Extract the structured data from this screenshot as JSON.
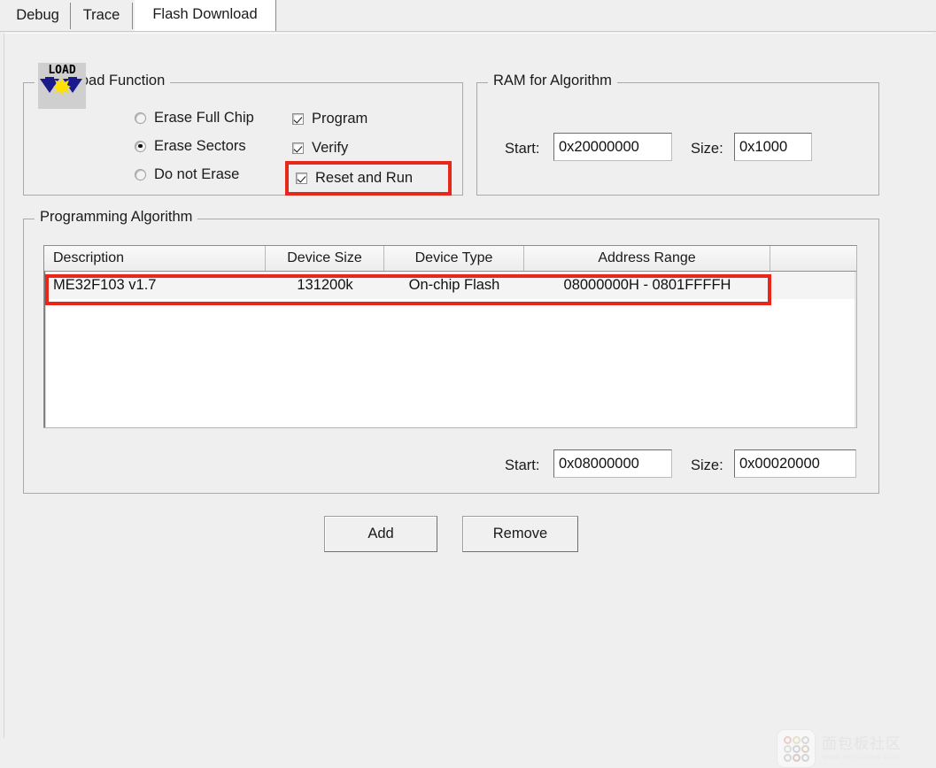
{
  "tabs": [
    {
      "label": "Debug",
      "active": false
    },
    {
      "label": "Trace",
      "active": false
    },
    {
      "label": "Flash Download",
      "active": true
    }
  ],
  "download_function": {
    "title": "Download Function",
    "icon": "load-icon",
    "icon_text": "LOAD",
    "erase_options": [
      {
        "label": "Erase Full Chip",
        "selected": false
      },
      {
        "label": "Erase Sectors",
        "selected": true
      },
      {
        "label": "Do not Erase",
        "selected": false
      }
    ],
    "checkboxes": [
      {
        "label": "Program",
        "checked": true
      },
      {
        "label": "Verify",
        "checked": true
      },
      {
        "label": "Reset and Run",
        "checked": true,
        "highlighted": true
      }
    ]
  },
  "ram_for_algorithm": {
    "title": "RAM for Algorithm",
    "start_label": "Start:",
    "start_value": "0x20000000",
    "size_label": "Size:",
    "size_value": "0x1000"
  },
  "programming_algorithm": {
    "title": "Programming Algorithm",
    "columns": [
      "Description",
      "Device Size",
      "Device Type",
      "Address Range",
      ""
    ],
    "rows": [
      {
        "description": "ME32F103 v1.7",
        "device_size": "131200k",
        "device_type": "On-chip Flash",
        "address_range": "08000000H - 0801FFFFH",
        "extra": "",
        "highlighted": true
      }
    ],
    "start_label": "Start:",
    "start_value": "0x08000000",
    "size_label": "Size:",
    "size_value": "0x00020000"
  },
  "buttons": {
    "add": "Add",
    "remove": "Remove"
  },
  "watermark": {
    "title": "面包板社区",
    "url": "www.eet-china.com"
  },
  "colors": {
    "highlight_red": "#e8261a",
    "window_bg": "#efefef",
    "field_bg": "#ffffff"
  }
}
